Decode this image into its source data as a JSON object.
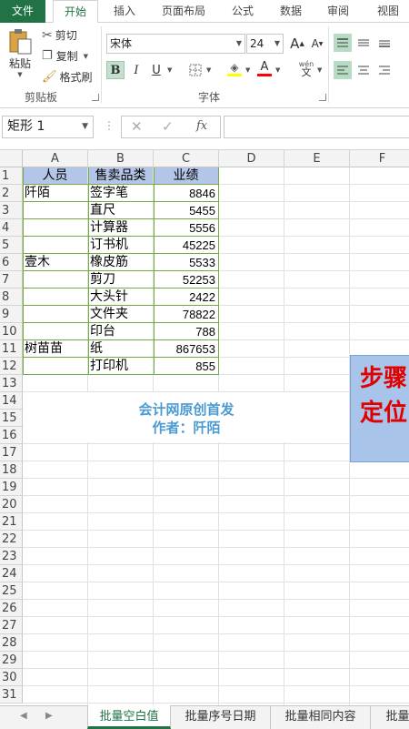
{
  "ribbon_tabs": [
    "文件",
    "开始",
    "插入",
    "页面布局",
    "公式",
    "数据",
    "审阅",
    "视图"
  ],
  "clipboard": {
    "paste_label": "粘贴",
    "cut_label": "剪切",
    "copy_label": "复制",
    "format_painter_label": "格式刷",
    "group_label": "剪贴板"
  },
  "font": {
    "name": "宋体",
    "size": "24",
    "group_label": "字体",
    "bold": "B",
    "italic": "I",
    "underline": "U",
    "wen_label": "wén",
    "wen_char": "文",
    "grow": "A",
    "shrink": "A",
    "fill_color": "#ffff00",
    "font_color": "#ff0000"
  },
  "formula_bar": {
    "name_box": "矩形 1",
    "formula": ""
  },
  "columns": [
    "A",
    "B",
    "C",
    "D",
    "E",
    "F"
  ],
  "rows": [
    "1",
    "2",
    "3",
    "4",
    "5",
    "6",
    "7",
    "8",
    "9",
    "10",
    "11",
    "12",
    "13",
    "14",
    "15",
    "16",
    "17",
    "18",
    "19",
    "20",
    "21",
    "22",
    "23",
    "24",
    "25",
    "26",
    "27",
    "28",
    "29",
    "30",
    "31"
  ],
  "table": {
    "header": [
      "人员",
      "售卖品类",
      "业绩"
    ],
    "rows": [
      [
        "阡陌",
        "签字笔",
        "8846"
      ],
      [
        "",
        "直尺",
        "5455"
      ],
      [
        "",
        "计算器",
        "5556"
      ],
      [
        "",
        "订书机",
        "45225"
      ],
      [
        "壹木",
        "橡皮筋",
        "5533"
      ],
      [
        "",
        "剪刀",
        "52253"
      ],
      [
        "",
        "大头针",
        "2422"
      ],
      [
        "",
        "文件夹",
        "78822"
      ],
      [
        "",
        "印台",
        "788"
      ],
      [
        "树苗苗",
        "纸",
        "867653"
      ],
      [
        "",
        "打印机",
        "855"
      ]
    ]
  },
  "watermark": {
    "line1": "会计网原创首发",
    "line2": "作者：阡陌"
  },
  "shape_text": {
    "line1": "步骤",
    "line2": "定位"
  },
  "sheet_tabs": [
    "批量空白值",
    "批量序号日期",
    "批量相同内容",
    "批量"
  ],
  "colors": {
    "excel_green": "#217346",
    "header_fill": "#b4c6e7",
    "table_border": "#70ad47",
    "shape_fill": "#a9c4ea",
    "shape_text": "#e00000",
    "watermark_text": "#4b9bd2"
  }
}
